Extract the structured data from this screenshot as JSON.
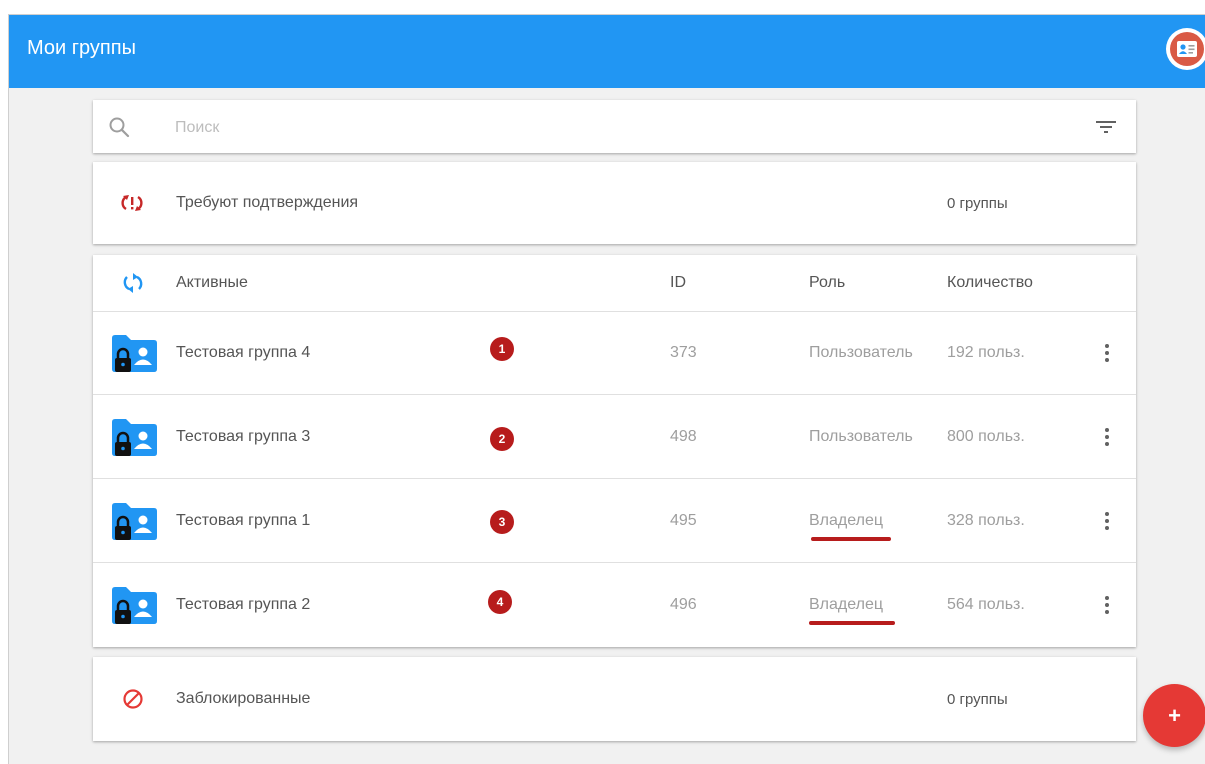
{
  "header": {
    "title": "Мои группы",
    "account_icon": "contact-card-icon"
  },
  "search": {
    "placeholder": "Поиск",
    "value": "",
    "filter_icon": "filter-icon"
  },
  "pending": {
    "label": "Требуют подтверждения",
    "count": "0 группы",
    "icon": "pending-sync-icon"
  },
  "active": {
    "label": "Активные",
    "icon": "sync-icon",
    "columns": {
      "id": "ID",
      "role": "Роль",
      "count": "Количество"
    },
    "rows": [
      {
        "name": "Тестовая группа 4",
        "badge": "1",
        "id": "373",
        "role": "Пользователь",
        "count": "192 польз."
      },
      {
        "name": "Тестовая группа 3",
        "badge": "2",
        "id": "498",
        "role": "Пользователь",
        "count": "800 польз."
      },
      {
        "name": "Тестовая группа 1",
        "badge": "3",
        "id": "495",
        "role": "Владелец",
        "count": "328 польз."
      },
      {
        "name": "Тестовая группа 2",
        "badge": "4",
        "id": "496",
        "role": "Владелец",
        "count": "564 польз."
      }
    ]
  },
  "blocked": {
    "label": "Заблокированные",
    "count": "0 группы",
    "icon": "block-icon"
  },
  "fab": {
    "label": "+"
  },
  "colors": {
    "appbar": "#2196f3",
    "accent_red": "#b71c1c",
    "fab": "#e53935",
    "folder_icon": "#2196f3"
  }
}
